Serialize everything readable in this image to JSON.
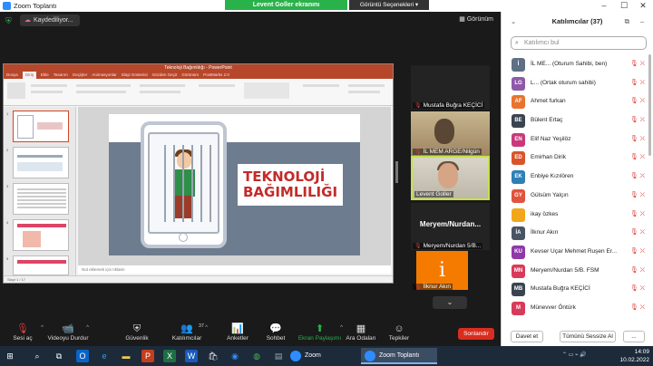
{
  "window": {
    "title": "Zoom Toplantı",
    "share_banner": "Levent Goller ekranını görüntülüyorsunuz",
    "view_options": "Görüntü Seçenekleri"
  },
  "meeting": {
    "saving_label": "Kaydediliyor...",
    "view_button": "Görünüm"
  },
  "powerpoint": {
    "title": "Teknoloji Bağımlılığı - PowerPoint",
    "tabs": [
      "Dosya",
      "Giriş",
      "Ekle",
      "Tasarım",
      "Geçişler",
      "Animasyonlar",
      "Slayt Gösterisi",
      "Gözden Geçir",
      "Görünüm",
      "PostMarks 2.0"
    ],
    "slide_numbers": [
      "1",
      "2",
      "3",
      "4",
      "5"
    ],
    "slide_title_line1": "TEKNOLOJİ",
    "slide_title_line2": "BAĞIMLILIĞI",
    "notes_placeholder": "Not eklemek için tıklatın",
    "status": "Slayt 1 / 17"
  },
  "videos": [
    {
      "name": "Mustafa Buğra KEÇİCİ"
    },
    {
      "name": "İL MEM ARGE/Nilgün"
    },
    {
      "name": "Levent Goller"
    },
    {
      "name": "Meryem/Nurdan 5/B..."
    },
    {
      "name": "İlknur Akın"
    }
  ],
  "big_name_label": "Meryem/Nurdan...",
  "avatar_tile_letter": "i",
  "toolbar": {
    "items": [
      {
        "label": "Sesi aç",
        "icon": "🎙"
      },
      {
        "label": "Videoyu Durdur",
        "icon": "📹"
      },
      {
        "label": "Güvenlik",
        "icon": "🛡"
      },
      {
        "label": "Katılımcılar",
        "icon": "👥",
        "count": "37"
      },
      {
        "label": "Anketler",
        "icon": "📊"
      },
      {
        "label": "Sohbet",
        "icon": "💬"
      },
      {
        "label": "Ekran Paylaşımı",
        "icon": "⬆"
      },
      {
        "label": "Ara Odaları",
        "icon": "▦"
      },
      {
        "label": "Tepkiler",
        "icon": "☺"
      }
    ],
    "end_label": "Sonlandır"
  },
  "participants": {
    "title": "Katılımcılar (37)",
    "search_placeholder": "Katılımcı bul",
    "list": [
      {
        "initials": "İ",
        "name": "İL ME... (Oturum Sahibi, ben)",
        "color": "#607084"
      },
      {
        "initials": "LG",
        "name": "L... (Ortak oturum sahibi)",
        "color": "#8e5aa8"
      },
      {
        "initials": "AF",
        "name": "Ahmet furkan",
        "color": "#e8742f"
      },
      {
        "initials": "BE",
        "name": "Bülent Ertaç",
        "color": "#3a4451"
      },
      {
        "initials": "EN",
        "name": "Elif Naz Yeşilöz",
        "color": "#c83a7a"
      },
      {
        "initials": "ED",
        "name": "Emirhan Dirik",
        "color": "#d9542b"
      },
      {
        "initials": "EK",
        "name": "Enbiye  Kızılören",
        "color": "#2e7fb8"
      },
      {
        "initials": "GY",
        "name": "Gülsüm Yalçın",
        "color": "#e0533c"
      },
      {
        "initials": "",
        "name": "ikay özkes",
        "color": "#f2a71b"
      },
      {
        "initials": "İA",
        "name": "İlknur Akın",
        "color": "#4a5563"
      },
      {
        "initials": "KU",
        "name": "Kevser Uçar Mehmet Ruşen Er...",
        "color": "#8e3aa8"
      },
      {
        "initials": "MN",
        "name": "Meryem/Nurdan 5/B.   FSM",
        "color": "#d83b5a"
      },
      {
        "initials": "MB",
        "name": "Mustafa Buğra KEÇİCİ",
        "color": "#3a4451"
      },
      {
        "initials": "M",
        "name": "Münevver Öntürk",
        "color": "#d83b5a"
      }
    ],
    "invite_label": "Davet et",
    "mute_all_label": "Tümünü Sessize Al",
    "more_label": "..."
  },
  "taskbar": {
    "zoom_items": [
      "Zoom",
      "Zoom Toplantı"
    ],
    "time": "14:09",
    "date": "10.02.2022"
  }
}
